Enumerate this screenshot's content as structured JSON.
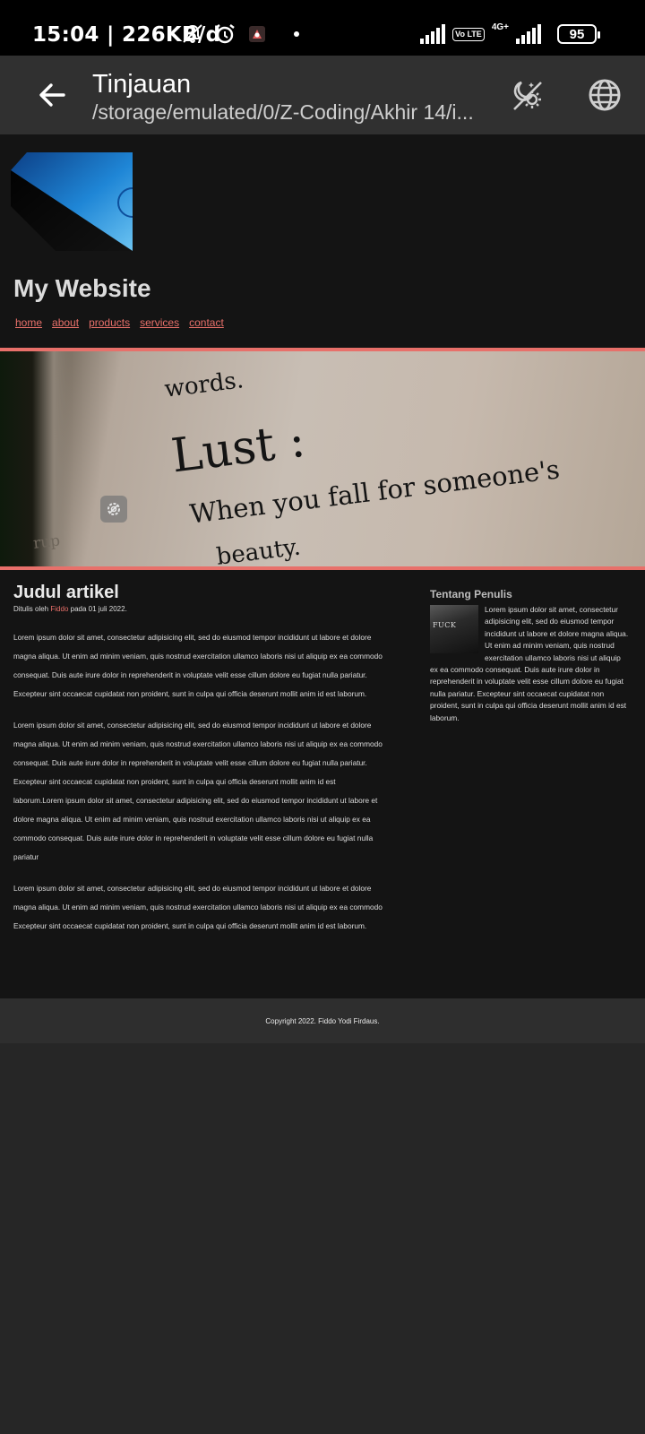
{
  "status_bar": {
    "time": "15:04 | 226KB/d",
    "network": "4G+",
    "volte": "Vo LTE",
    "battery": "95",
    "icons": [
      "notifications-off-icon",
      "alarm-icon",
      "app-notification-icon",
      "dot-icon",
      "signal-icon",
      "volte-icon",
      "signal-4g-icon",
      "battery-icon"
    ]
  },
  "app_bar": {
    "title": "Tinjauan",
    "subtitle": "/storage/emulated/0/Z-Coding/Akhir 14/i...",
    "icons": [
      "back-arrow-icon",
      "night-mode-icon",
      "globe-icon"
    ]
  },
  "site": {
    "title": "My Website",
    "nav": [
      "home",
      "about",
      "products",
      "services",
      "contact"
    ],
    "hero_text": {
      "line1": "words.",
      "line2": "Lust :",
      "line3": "When you fall for someone's",
      "line4": "beauty.",
      "side": "rup"
    },
    "article": {
      "title": "Judul artikel",
      "byline_prefix": "Ditulis oleh",
      "author": "Fiddo",
      "byline_suffix": "pada 01 juli 2022.",
      "paragraphs": [
        "Lorem ipsum dolor sit amet, consectetur adipisicing elit, sed do eiusmod tempor incididunt ut labore et dolore magna aliqua. Ut enim ad minim veniam, quis nostrud exercitation ullamco laboris nisi ut aliquip ex ea commodo consequat. Duis aute irure dolor in reprehenderit in voluptate velit esse cillum dolore eu fugiat nulla pariatur. Excepteur sint occaecat cupidatat non proident, sunt in culpa qui officia deserunt mollit anim id est laborum.",
        "Lorem ipsum dolor sit amet, consectetur adipisicing elit, sed do eiusmod tempor incididunt ut labore et dolore magna aliqua. Ut enim ad minim veniam, quis nostrud exercitation ullamco laboris nisi ut aliquip ex ea commodo consequat. Duis aute irure dolor in reprehenderit in voluptate velit esse cillum dolore eu fugiat nulla pariatur. Excepteur sint occaecat cupidatat non proident, sunt in culpa qui officia deserunt mollit anim id est laborum.Lorem ipsum dolor sit amet, consectetur adipisicing elit, sed do eiusmod tempor incididunt ut labore et dolore magna aliqua. Ut enim ad minim veniam, quis nostrud exercitation ullamco laboris nisi ut aliquip ex ea commodo consequat. Duis aute irure dolor in reprehenderit in voluptate velit esse cillum dolore eu fugiat nulla pariatur",
        "Lorem ipsum dolor sit amet, consectetur adipisicing elit, sed do eiusmod tempor incididunt ut labore et dolore magna aliqua. Ut enim ad minim veniam, quis nostrud exercitation ullamco laboris nisi ut aliquip ex ea commodo Excepteur sint occaecat cupidatat non proident, sunt in culpa qui officia deserunt mollit anim id est laborum."
      ]
    },
    "aside": {
      "title": "Tentang Penulis",
      "image_text": "FUCK",
      "body": "Lorem ipsum dolor sit amet, consectetur adipisicing elit, sed do eiusmod tempor incididunt ut labore et dolore magna aliqua. Ut enim ad minim veniam, quis nostrud exercitation ullamco laboris nisi ut aliquip ex ea commodo consequat. Duis aute irure dolor in reprehenderit in voluptate velit esse cillum dolore eu fugiat nulla pariatur. Excepteur sint occaecat cupidatat non proident, sunt in culpa qui officia deserunt mollit anim id est laborum."
    },
    "footer": "Copyright 2022. Fiddo Yodi Firdaus."
  },
  "colors": {
    "accent": "#e8706a",
    "page_bg": "#141414",
    "app_bar": "#303030",
    "footer": "#2e2e2e",
    "logo_blue": "#1f86d6"
  }
}
